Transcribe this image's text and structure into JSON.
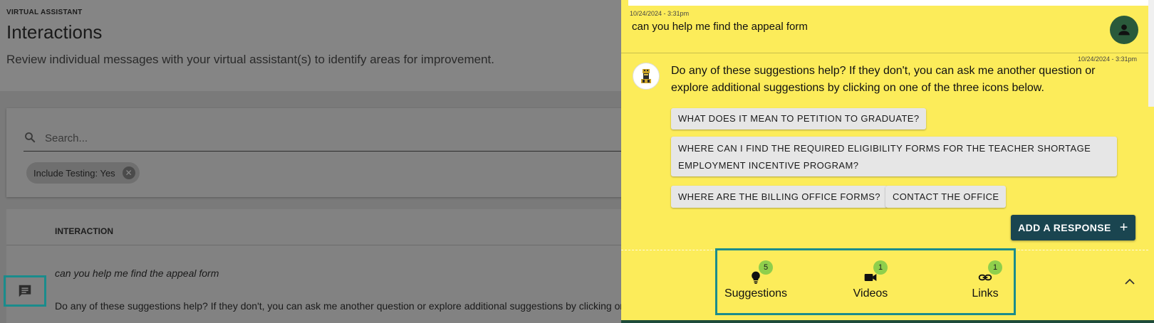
{
  "header": {
    "overline": "VIRTUAL ASSISTANT",
    "title": "Interactions",
    "subtitle": "Review individual messages with your virtual assistant(s) to identify areas for improvement."
  },
  "filter": {
    "search_placeholder": "Search...",
    "chip_label": "Include Testing: Yes"
  },
  "table": {
    "column_header": "INTERACTION",
    "row_title": "can you help me find the appeal form",
    "row_message": "Do any of these suggestions help? If they don't, you can ask me another question or explore additional suggestions by clicking on"
  },
  "panel": {
    "user_timestamp": "10/24/2024 - 3:31pm",
    "user_message": "can you help me find the appeal form",
    "bot_timestamp": "10/24/2024 - 3:31pm",
    "bot_message": "Do any of these suggestions help? If they don't, you can ask me another question or explore additional suggestions by clicking on one of the three icons below.",
    "suggestions": [
      "WHAT DOES IT MEAN TO PETITION TO GRADUATE?",
      "WHERE CAN I FIND THE REQUIRED ELIGIBILITY FORMS FOR THE TEACHER SHORTAGE EMPLOYMENT INCENTIVE PROGRAM?",
      "WHERE ARE THE BILLING OFFICE FORMS?",
      "CONTACT THE OFFICE"
    ],
    "add_response_label": "ADD A RESPONSE",
    "add_response_icon": "+",
    "resources": [
      {
        "label": "Suggestions",
        "count": "5",
        "icon": "lightbulb-icon"
      },
      {
        "label": "Videos",
        "count": "1",
        "icon": "videocam-icon"
      },
      {
        "label": "Links",
        "count": "1",
        "icon": "link-icon"
      }
    ]
  },
  "colors": {
    "panel_bg": "#fcec5a",
    "accent": "#1a4550",
    "highlight": "#1a8c8c",
    "badge": "#8fcf4c"
  }
}
